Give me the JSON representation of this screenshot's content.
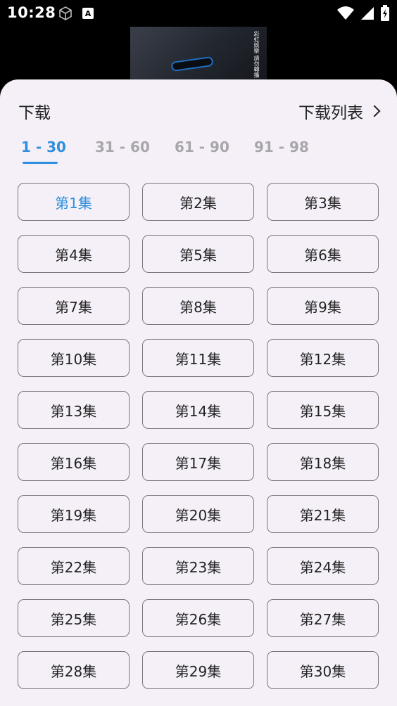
{
  "status_bar": {
    "time": "10:28"
  },
  "sheet": {
    "title": "下载",
    "download_list_label": "下载列表"
  },
  "tabs": [
    {
      "label": "1 - 30",
      "active": true
    },
    {
      "label": "31 - 60",
      "active": false
    },
    {
      "label": "61 - 90",
      "active": false
    },
    {
      "label": "91 - 98",
      "active": false
    }
  ],
  "episodes": [
    "第1集",
    "第2集",
    "第3集",
    "第4集",
    "第5集",
    "第6集",
    "第7集",
    "第8集",
    "第9集",
    "第10集",
    "第11集",
    "第12集",
    "第13集",
    "第14集",
    "第15集",
    "第16集",
    "第17集",
    "第18集",
    "第19集",
    "第20集",
    "第21集",
    "第22集",
    "第23集",
    "第24集",
    "第25集",
    "第26集",
    "第27集",
    "第28集",
    "第29集",
    "第30集"
  ],
  "selected_episode_index": 0,
  "video_overlay_text": "彩虹娛樂 請勿轉播",
  "colors": {
    "accent": "#2f8fdf",
    "sheet_background": "#f5f0f8",
    "tab_inactive": "#a8a6ab",
    "button_border": "#7a767d"
  }
}
